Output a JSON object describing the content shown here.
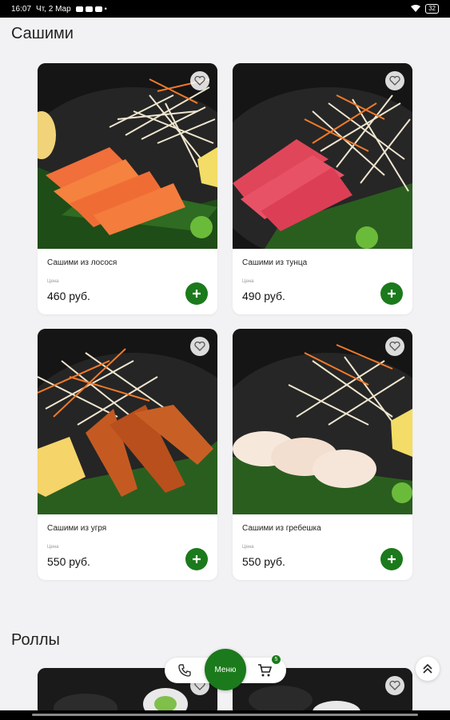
{
  "status_bar": {
    "time": "16:07",
    "date": "Чт, 2 Мар",
    "battery": "32"
  },
  "sections": [
    {
      "title": "Сашими"
    },
    {
      "title": "Роллы"
    }
  ],
  "price_caption": "Цена",
  "products": [
    {
      "name": "Сашими из лосося",
      "price": "460 руб."
    },
    {
      "name": "Сашими из тунца",
      "price": "490 руб."
    },
    {
      "name": "Сашими из угря",
      "price": "550 руб."
    },
    {
      "name": "Сашими из гребешка",
      "price": "550 руб."
    }
  ],
  "nav": {
    "menu_label": "Меню",
    "cart_count": "5"
  },
  "colors": {
    "accent": "#1b7a1b",
    "background": "#f2f2f4"
  }
}
